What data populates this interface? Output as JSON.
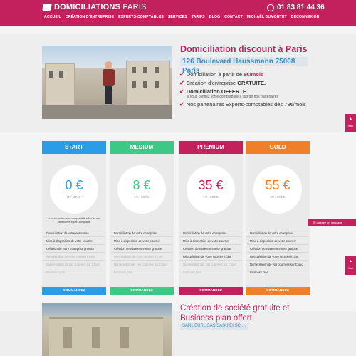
{
  "header": {
    "brand_bold": "DOMICILIATIONS",
    "brand_thin": "PARIS",
    "phone": "01 83 81 44 36",
    "nav": [
      "ACCUEIL",
      "CRÉATION D'ENTREPRISE",
      "EXPERTS-COMPTABLES",
      "SERVICES",
      "TARIFS",
      "BLOG",
      "CONTACT",
      "MICHAËL DUMONTET",
      "DÉCONNEXION"
    ]
  },
  "hero": {
    "title": "Domiciliation discount à Paris",
    "address": "126 Boulevard Haussmann 75008 Paris",
    "features": [
      {
        "text": "Domiciliation à partir de",
        "highlight": "8€/mois",
        "sub": ""
      },
      {
        "text": "Création d'entreprise",
        "highlight": "GRATUITE.",
        "sub": ""
      },
      {
        "text": "Domiciliation OFFERTE",
        "highlight": "",
        "sub": "si vous confiez votre comptabilité à l'un de nos partenaires"
      },
      {
        "text": "Nos partenaires Experts-comptables dès 79€/mois",
        "highlight": "",
        "sub": ""
      }
    ]
  },
  "side_tabs": [
    {
      "label": "Haut",
      "color": "#c3215e"
    },
    {
      "label": "Haut",
      "color": "#c3215e"
    }
  ],
  "plans": [
    {
      "name": "START",
      "color": "#2b9ce8",
      "price": "0 €",
      "per": "HT / MOIS *",
      "note": "si vous confiez votre comptabilité à l'un de nos partenaires expert-comptable",
      "items": [
        {
          "label": "Domiciliation de votre entreprise",
          "off": false
        },
        {
          "label": "Mise à disposition de votre courrier",
          "off": false
        },
        {
          "label": "Création de votre entreprise gratuite",
          "off": false
        },
        {
          "label": "Réexpédition de votre courrier inclus",
          "off": true
        },
        {
          "label": "Numérisation de vos courriers sur Cloud",
          "off": true
        },
        {
          "label": "Business plan",
          "off": true
        }
      ],
      "button": "COMMANDEZ"
    },
    {
      "name": "MEDIUM",
      "color": "#3ec887",
      "price": "8 €",
      "per": "HT / MOIS",
      "note": "",
      "items": [
        {
          "label": "Domiciliation de votre entreprise",
          "off": false
        },
        {
          "label": "Mise à disposition de votre courrier",
          "off": false
        },
        {
          "label": "Création de votre entreprise gratuite",
          "off": false
        },
        {
          "label": "Réexpédition de votre courrier inclus",
          "off": true
        },
        {
          "label": "Numérisation de vos courriers sur Cloud",
          "off": true
        },
        {
          "label": "Business plan",
          "off": true
        }
      ],
      "button": "COMMANDEZ"
    },
    {
      "name": "PREMIUM",
      "color": "#c3215e",
      "price": "35 €",
      "per": "HT / MOIS",
      "note": "",
      "items": [
        {
          "label": "Domiciliation de votre entreprise",
          "off": false
        },
        {
          "label": "Mise à disposition de votre courrier",
          "off": false
        },
        {
          "label": "Création de votre entreprise gratuite",
          "off": false
        },
        {
          "label": "Réexpédition de votre courrier inclus",
          "off": false
        },
        {
          "label": "Numérisation de vos courriers sur Cloud",
          "off": true
        },
        {
          "label": "Business plan",
          "off": true
        }
      ],
      "button": "COMMANDEZ"
    },
    {
      "name": "GOLD",
      "color": "#f07f2a",
      "price": "55 €",
      "per": "HT / MOIS",
      "note": "",
      "items": [
        {
          "label": "Domiciliation de votre entreprise",
          "off": false
        },
        {
          "label": "Mise à disposition de votre courrier",
          "off": false
        },
        {
          "label": "Création de votre entreprise gratuite",
          "off": false
        },
        {
          "label": "Réexpédition de votre courrier inclus",
          "off": false
        },
        {
          "label": "Numérisation de vos courriers sur Cloud",
          "off": false
        },
        {
          "label": "Business plan",
          "off": false
        }
      ],
      "button": "COMMANDEZ"
    }
  ],
  "chat": {
    "label": "Laissez un message"
  },
  "bottom": {
    "title": "Création de société gratuite et Business plan offert",
    "tag": "SARL EURL SAS SASU EI SCI…"
  }
}
